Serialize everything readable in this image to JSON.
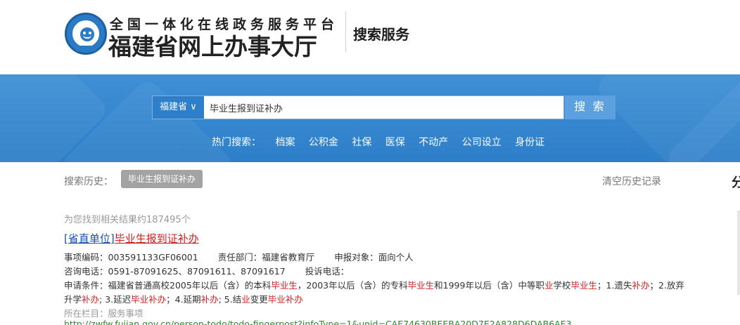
{
  "header": {
    "brand_sub": "全国一体化在线政务服务平台",
    "brand_main": "福建省网上办事大厅",
    "section_title": "搜索服务"
  },
  "search": {
    "region": "福建省 ∨",
    "query": "毕业生报到证补办",
    "button": "搜 索"
  },
  "hot": {
    "label": "热门搜索：",
    "items": [
      "档案",
      "公积金",
      "社保",
      "医保",
      "不动产",
      "公司设立",
      "身份证"
    ]
  },
  "history": {
    "label": "搜索历史：",
    "chip": "毕业生报到证补办",
    "clear": "清空历史记录",
    "edge_char": "分"
  },
  "results": {
    "count_text": "为您找到相关结果约187495个",
    "items": [
      {
        "tag": "[省直单位]",
        "title": "毕业生报到证补办",
        "code_label": "事项编码：003591133GF06001",
        "dept_label": "责任部门：福建省教育厅",
        "target_label": "申报对象：面向个人",
        "phone_label": "咨询电话：0591-87091625、87091611、87091617",
        "complaint_label": "投诉电话：",
        "cond_p1": "申请条件：福建省普通高校2005年以后（含）的本科",
        "cond_k1": "毕业生",
        "cond_p2": "，2003年以后（含）的专科",
        "cond_k2": "毕业生",
        "cond_p3": "和1999年以后（含）中等职",
        "cond_k3": "业",
        "cond_p4": "学校",
        "cond_k4": "毕业生",
        "cond_p5": "；1.遗失",
        "cond_k5": "补办",
        "cond_p6": "；2.放弃",
        "line4_p1": "升学",
        "line4_k1": "补办",
        "line4_p2": "; 3.延迟",
        "line4_k2": "毕业补办",
        "line4_p3": "；4.延期",
        "line4_k3": "补办",
        "line4_p4": "; 5.结",
        "line4_k4": "业",
        "line4_p5": "变更",
        "line4_k5": "毕业补办",
        "column_label": "所在栏目：服务事项",
        "url": "http://zwfw.fujian.gov.cn/person-todo/todo-fingerpost?infoType=1&unid=CAE74630BEEBA20D7E2A828D6DAB6AE3"
      }
    ]
  }
}
